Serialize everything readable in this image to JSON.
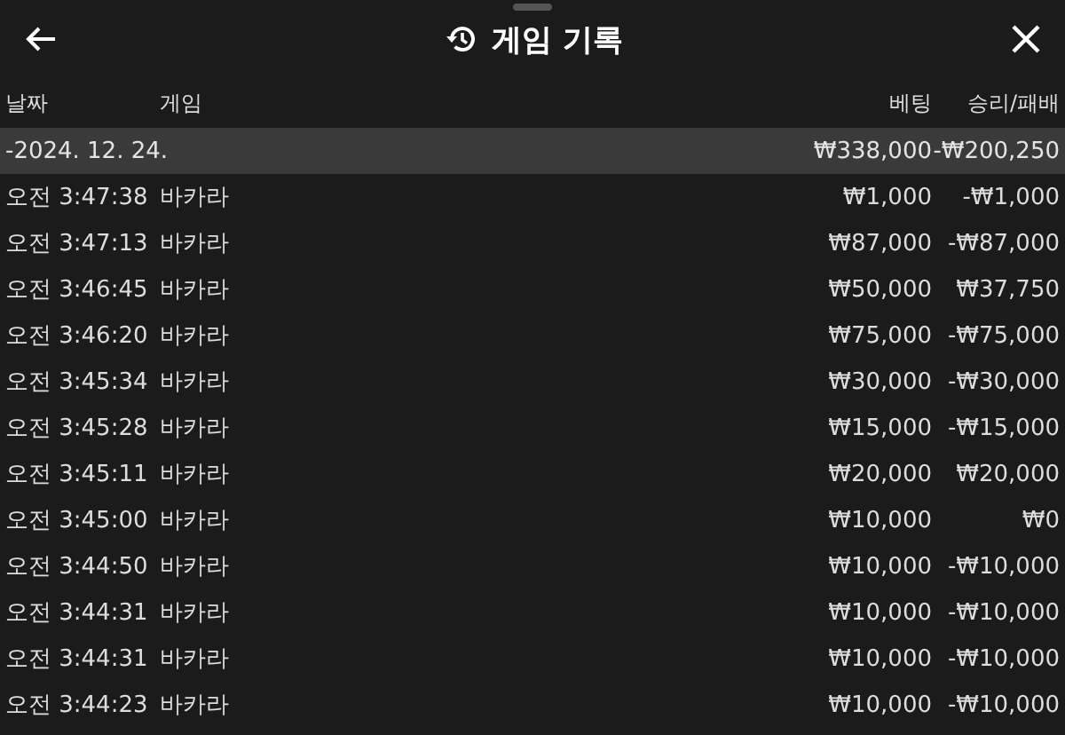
{
  "header": {
    "title": "게임 기록"
  },
  "columns": [
    "날짜",
    "게임",
    "베팅",
    "승리/패배"
  ],
  "group": {
    "date": "-2024. 12. 24.",
    "bet": "₩338,000",
    "result": "-₩200,250"
  },
  "rows": [
    {
      "time": "오전 3:47:38",
      "game": "바카라",
      "bet": "₩1,000",
      "result": "-₩1,000"
    },
    {
      "time": "오전 3:47:13",
      "game": "바카라",
      "bet": "₩87,000",
      "result": "-₩87,000"
    },
    {
      "time": "오전 3:46:45",
      "game": "바카라",
      "bet": "₩50,000",
      "result": "₩37,750"
    },
    {
      "time": "오전 3:46:20",
      "game": "바카라",
      "bet": "₩75,000",
      "result": "-₩75,000"
    },
    {
      "time": "오전 3:45:34",
      "game": "바카라",
      "bet": "₩30,000",
      "result": "-₩30,000"
    },
    {
      "time": "오전 3:45:28",
      "game": "바카라",
      "bet": "₩15,000",
      "result": "-₩15,000"
    },
    {
      "time": "오전 3:45:11",
      "game": "바카라",
      "bet": "₩20,000",
      "result": "₩20,000"
    },
    {
      "time": "오전 3:45:00",
      "game": "바카라",
      "bet": "₩10,000",
      "result": "₩0"
    },
    {
      "time": "오전 3:44:50",
      "game": "바카라",
      "bet": "₩10,000",
      "result": "-₩10,000"
    },
    {
      "time": "오전 3:44:31",
      "game": "바카라",
      "bet": "₩10,000",
      "result": "-₩10,000"
    },
    {
      "time": "오전 3:44:31",
      "game": "바카라",
      "bet": "₩10,000",
      "result": "-₩10,000"
    },
    {
      "time": "오전 3:44:23",
      "game": "바카라",
      "bet": "₩10,000",
      "result": "-₩10,000"
    }
  ]
}
